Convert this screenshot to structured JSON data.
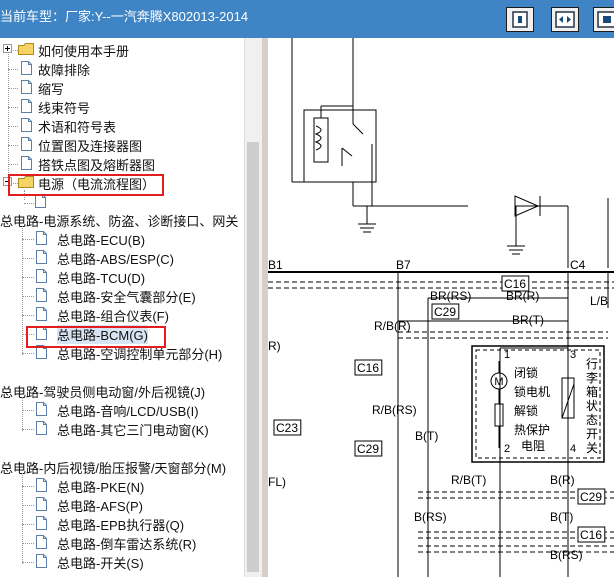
{
  "window": {
    "title": "当前车型：厂家:Y--一汽奔腾X802013-2014"
  },
  "toolbar": {
    "buttons": [
      "fit-page",
      "fit-width",
      "actual-size"
    ]
  },
  "tree": {
    "top_items": [
      {
        "label": "如何使用本手册",
        "type": "folder"
      },
      {
        "label": "故障排除",
        "type": "doc"
      },
      {
        "label": "缩写",
        "type": "doc"
      },
      {
        "label": "线束符号",
        "type": "doc"
      },
      {
        "label": "术语和符号表",
        "type": "doc"
      },
      {
        "label": "位置图及连接器图",
        "type": "doc"
      },
      {
        "label": "搭铁点图及熔断器图",
        "type": "doc"
      },
      {
        "label": "电源（电流流程图）",
        "type": "folder-open"
      }
    ],
    "groups": [
      {
        "label": "总电路-电源系统、防盗、诊断接口、网关",
        "items": [
          "总电路-ECU(B)",
          "总电路-ABS/ESP(C)",
          "总电路-TCU(D)",
          "总电路-安全气囊部分(E)",
          "总电路-组合仪表(F)",
          "总电路-BCM(G)",
          "总电路-空调控制单元部分(H)"
        ]
      },
      {
        "label": "总电路-驾驶员侧电动窗/外后视镜(J)",
        "items": [
          "总电路-音响/LCD/USB(I)",
          "总电路-其它三门电动窗(K)"
        ]
      },
      {
        "label": "总电路-内后视镜/胎压报警/天窗部分(M)",
        "items": [
          "总电路-PKE(N)",
          "总电路-AFS(P)",
          "总电路-EPB执行器(Q)",
          "总电路-倒车雷达系统(R)",
          "总电路-开关(S)"
        ]
      }
    ],
    "selected_item": "总电路-BCM(G)"
  },
  "diagram": {
    "pins": [
      "B1",
      "B7",
      "C4"
    ],
    "connectors": [
      "C16",
      "C29",
      "C16",
      "C29",
      "C23",
      "C29",
      "C16"
    ],
    "wires": [
      "BR(RS)",
      "BR(R)",
      "BR(T)",
      "R/B(R)",
      "R/B(RS)",
      "B(T)",
      "R/B(T)",
      "B(RS)",
      "B(R)",
      "B(T)",
      "B(RS)",
      "L/B"
    ],
    "side_labels": [
      "R)",
      "FL)"
    ],
    "actuator": {
      "pin_numbers": [
        "1",
        "2",
        "3",
        "4"
      ],
      "motor_symbol": "M",
      "labels": [
        "闭锁",
        "锁电机",
        "解锁",
        "热保护",
        "电阻"
      ],
      "switch_label": "行李箱状态开关"
    }
  }
}
